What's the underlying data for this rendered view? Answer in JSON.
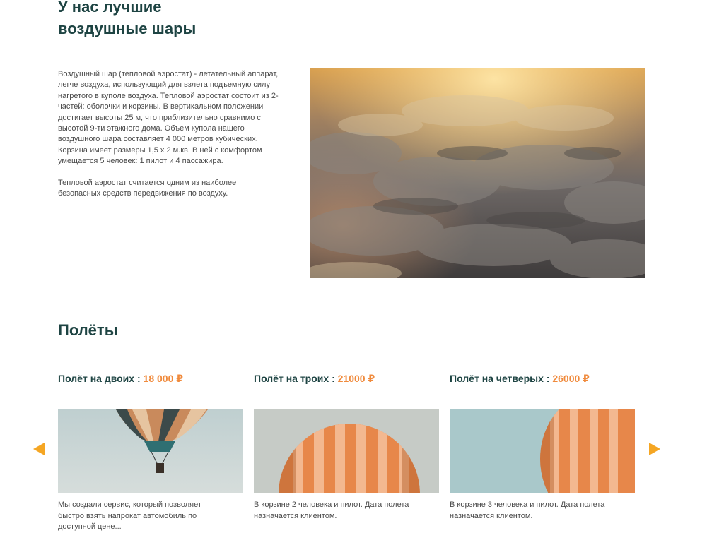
{
  "about": {
    "title_line1": "У нас лучшие",
    "title_line2": "воздушные шары",
    "paragraph1": "Воздушный шар (тепловой аэростат) - летательный аппарат, легче воздуха, использующий для взлета подъемную силу нагретого в куполе воздуха. Тепловой аэростат состоит из 2- частей: оболочки и корзины. В вертикальном положении достигает высоты 25 м, что приблизительно сравнимо с высотой 9-ти этажного дома. Объем купола нашего воздушного шара составляет 4 000 метров кубических. Корзина имеет размеры 1,5 х 2 м.кв. В ней с комфортом умещается 5 человек: 1 пилот и 4 пассажира.",
    "paragraph2": "Тепловой аэростат считается одним из наиболее безопасных средств передвижения по воздуху.",
    "photo": "sky-clouds-photo"
  },
  "flights": {
    "title": "Полёты",
    "cards": [
      {
        "name": "Полёт на двоих : ",
        "price": "18 000 ₽",
        "image": "balloon-with-basket-photo",
        "description": "Мы создали сервис, который позволяет быстро взять напрокат автомобиль по доступной цене..."
      },
      {
        "name": "Полёт на троих : ",
        "price": "21000 ₽",
        "image": "orange-balloon-photo",
        "description": "В корзине 2 человека и пилот. Дата полета назначается клиентом."
      },
      {
        "name": "Полёт на четверых : ",
        "price": "26000 ₽",
        "image": "orange-balloon-closeup-photo",
        "description": "В корзине 3 человека и пилот. Дата полета назначается клиентом."
      }
    ],
    "prev_icon": "arrow-left-icon",
    "next_icon": "arrow-right-icon"
  },
  "colors": {
    "heading": "#1e4443",
    "accent": "#f08a3c",
    "arrow": "#f5a623",
    "body_text": "#4b4b4b"
  }
}
